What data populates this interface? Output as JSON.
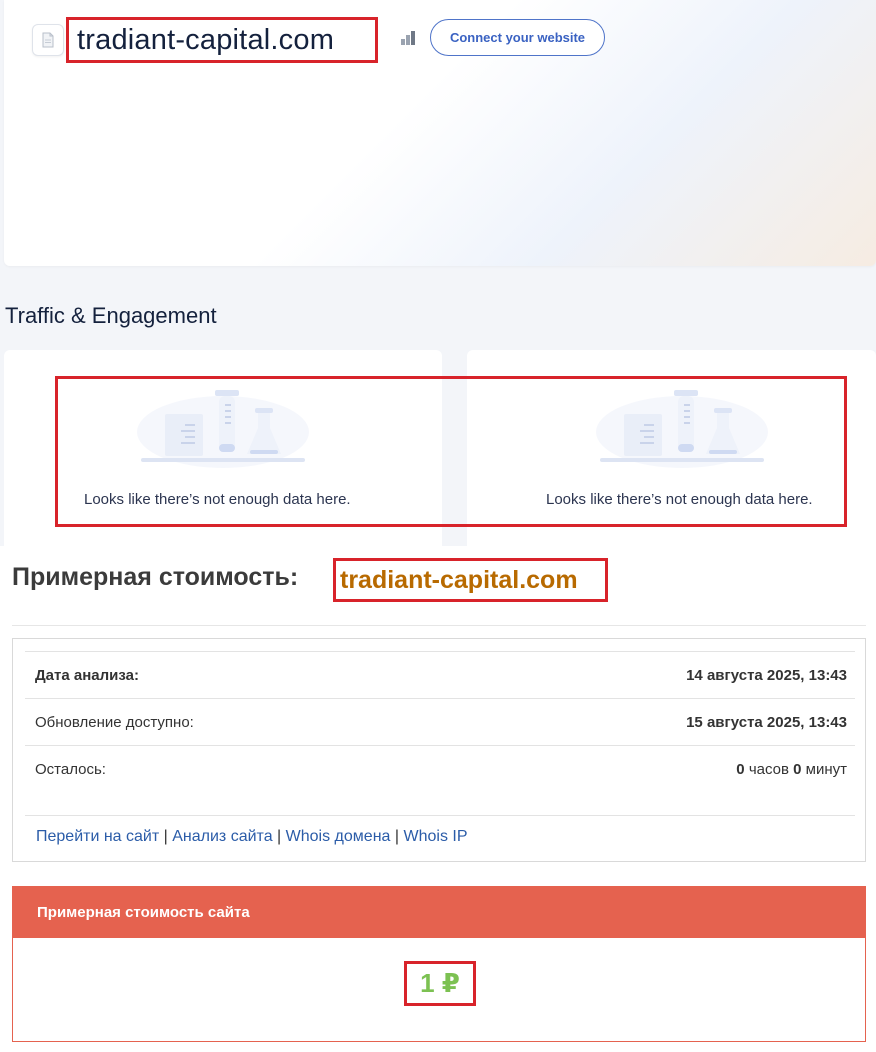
{
  "header": {
    "domain": "tradiant-capital.com",
    "connect_button": "Connect your website",
    "favicon_icon": "page-icon",
    "rank_icon": "bar-steps-icon"
  },
  "traffic": {
    "section_title": "Traffic & Engagement",
    "cards": [
      {
        "empty_message": "Looks like there’s not enough data here.",
        "illustration": "lab-flasks-icon"
      },
      {
        "empty_message": "Looks like there’s not enough data here.",
        "illustration": "lab-flasks-icon"
      }
    ]
  },
  "valuation": {
    "title_prefix": "Примерная стоимость:",
    "title_domain": "tradiant-capital.com",
    "rows": [
      {
        "label": "Дата анализа:",
        "value": "14 августа 2025, 13:43"
      },
      {
        "label": "Обновление доступно:",
        "value": "15 августа 2025, 13:43"
      },
      {
        "label": "Осталось:",
        "hours_num": "0",
        "hours_word": "часов",
        "minutes_num": "0",
        "minutes_word": "минут"
      }
    ],
    "links": [
      "Перейти на сайт",
      "Анализ сайта",
      "Whois домена",
      "Whois IP"
    ],
    "link_separator": "|",
    "panel_title": "Примерная стоимость сайта",
    "amount": "1 ₽"
  },
  "colors": {
    "highlight": "#d8232a",
    "accent_blue": "#3a62c2",
    "panel_red": "#e5624f",
    "price_green": "#7cc152",
    "domain_orange": "#b86a00"
  }
}
